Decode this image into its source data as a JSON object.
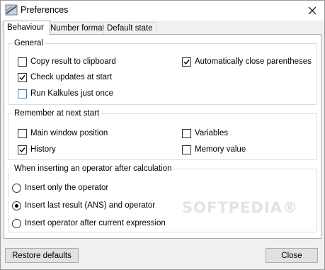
{
  "window": {
    "title": "Preferences",
    "icon": "kalkules-app-icon"
  },
  "tabs": [
    {
      "label": "Behaviour",
      "active": true
    },
    {
      "label": "Number format",
      "active": false
    },
    {
      "label": "Default state",
      "active": false
    }
  ],
  "general": {
    "legend": "General",
    "copy_result": {
      "label": "Copy result to clipboard",
      "checked": false
    },
    "auto_close": {
      "label": "Automatically close parentheses",
      "checked": true
    },
    "check_updates": {
      "label": "Check updates at start",
      "checked": true
    },
    "run_once": {
      "label": "Run Kalkules just once",
      "checked": false
    }
  },
  "remember": {
    "legend": "Remember at next start",
    "main_window": {
      "label": "Main window position",
      "checked": false
    },
    "variables": {
      "label": "Variables",
      "checked": false
    },
    "history": {
      "label": "History",
      "checked": true
    },
    "memory": {
      "label": "Memory value",
      "checked": false
    }
  },
  "operator": {
    "legend": "When inserting an operator after calculation",
    "options": [
      {
        "label": "Insert only the operator",
        "selected": false
      },
      {
        "label": "Insert last result (ANS) and operator",
        "selected": true
      },
      {
        "label": "Insert operator after current expression",
        "selected": false
      }
    ]
  },
  "buttons": {
    "restore": "Restore defaults",
    "close": "Close"
  },
  "watermark": "SOFTPEDIA®"
}
